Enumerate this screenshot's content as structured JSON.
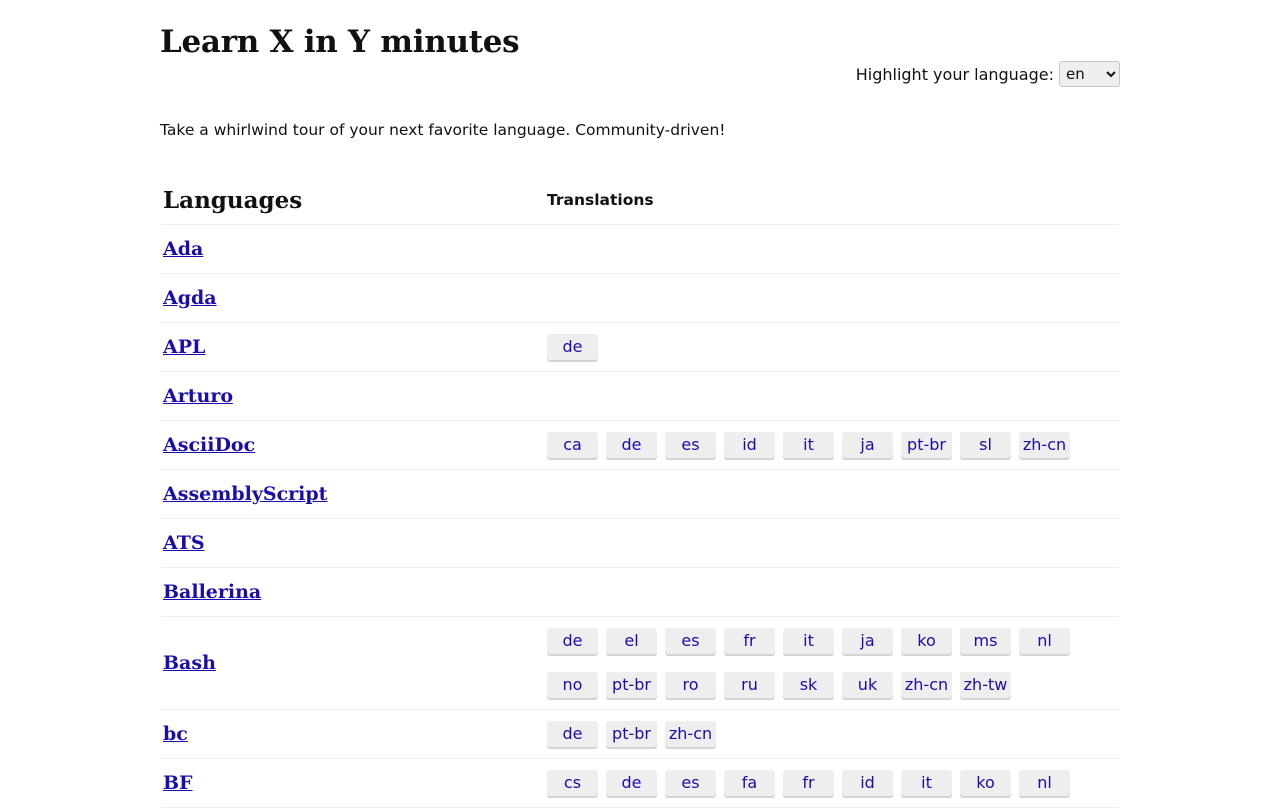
{
  "header": {
    "title": "Learn X in Y minutes"
  },
  "highlight": {
    "label": "Highlight your language:",
    "selected": "en"
  },
  "tagline": "Take a whirlwind tour of your next favorite language. Community-driven!",
  "table": {
    "col_languages": "Languages",
    "col_translations": "Translations",
    "rows": [
      {
        "name": "Ada",
        "translations": []
      },
      {
        "name": "Agda",
        "translations": []
      },
      {
        "name": "APL",
        "translations": [
          "de"
        ]
      },
      {
        "name": "Arturo",
        "translations": []
      },
      {
        "name": "AsciiDoc",
        "translations": [
          "ca",
          "de",
          "es",
          "id",
          "it",
          "ja",
          "pt-br",
          "sl",
          "zh-cn"
        ]
      },
      {
        "name": "AssemblyScript",
        "translations": []
      },
      {
        "name": "ATS",
        "translations": []
      },
      {
        "name": "Ballerina",
        "translations": []
      },
      {
        "name": "Bash",
        "translations": [
          "de",
          "el",
          "es",
          "fr",
          "it",
          "ja",
          "ko",
          "ms",
          "nl",
          "no",
          "pt-br",
          "ro",
          "ru",
          "sk",
          "uk",
          "zh-cn",
          "zh-tw"
        ]
      },
      {
        "name": "bc",
        "translations": [
          "de",
          "pt-br",
          "zh-cn"
        ]
      },
      {
        "name": "BF",
        "translations": [
          "cs",
          "de",
          "es",
          "fa",
          "fr",
          "id",
          "it",
          "ko",
          "nl"
        ]
      }
    ]
  }
}
